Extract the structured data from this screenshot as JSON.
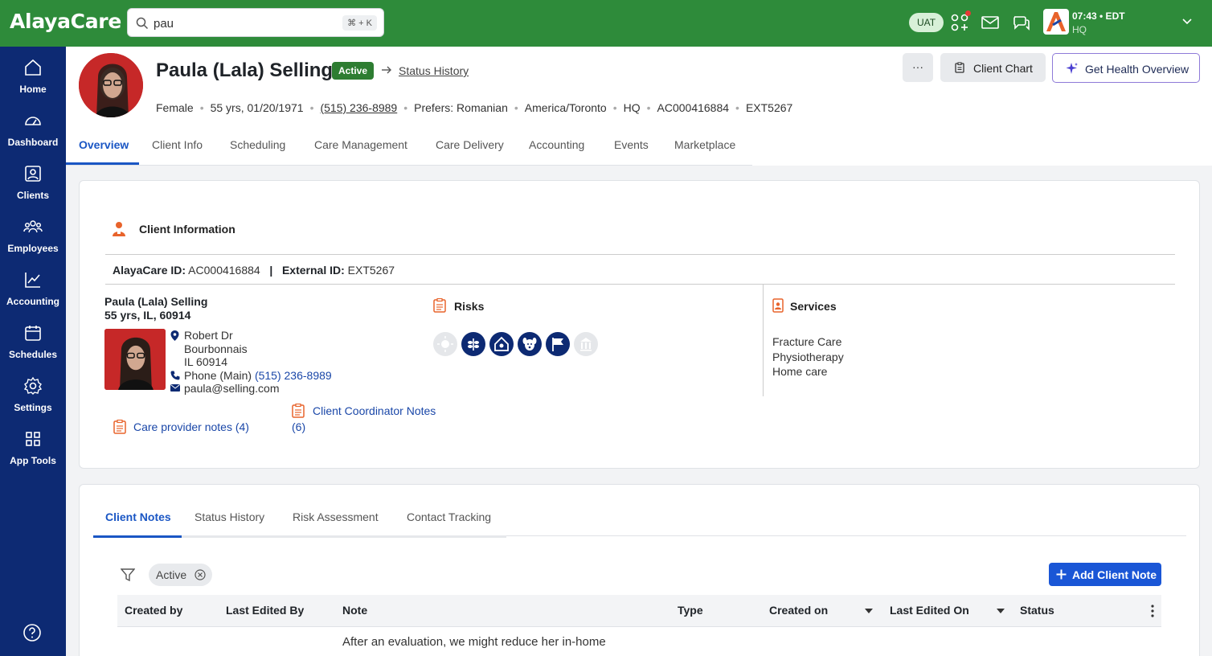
{
  "app": {
    "logo_text": "AlayaCare",
    "brand_green": "#2e8b3a",
    "nav_blue": "#0d2a73",
    "accent_blue": "#1a56c4"
  },
  "topbar": {
    "search_value": "pau",
    "search_shortcut": "⌘ + K",
    "env_badge": "UAT",
    "time": "07:43 • EDT",
    "location": "HQ",
    "icons": [
      "app-grid-icon",
      "mail-icon",
      "chat-icon"
    ]
  },
  "sidebar": {
    "items": [
      {
        "label": "Home",
        "icon": "home-icon"
      },
      {
        "label": "Dashboard",
        "icon": "dashboard-icon"
      },
      {
        "label": "Clients",
        "icon": "clients-icon"
      },
      {
        "label": "Employees",
        "icon": "employees-icon"
      },
      {
        "label": "Accounting",
        "icon": "accounting-icon"
      },
      {
        "label": "Schedules",
        "icon": "schedules-icon"
      },
      {
        "label": "Settings",
        "icon": "settings-icon"
      },
      {
        "label": "App Tools",
        "icon": "app-tools-icon"
      }
    ],
    "help_icon": "help-icon"
  },
  "client": {
    "name": "Paula (Lala) Selling",
    "status": "Active",
    "status_history_link": "Status History",
    "gender": "Female",
    "age_dob": "55 yrs, 01/20/1971",
    "phone": "(515) 236-8989",
    "language": "Prefers: Romanian",
    "timezone": "America/Toronto",
    "branch": "HQ",
    "alayacare_id": "AC000416884",
    "external_id": "EXT5267"
  },
  "header_actions": {
    "more": "···",
    "client_chart": "Client Chart",
    "health_overview": "Get Health Overview"
  },
  "tabs": [
    "Overview",
    "Client Info",
    "Scheduling",
    "Care Management",
    "Care Delivery",
    "Accounting",
    "Events",
    "Marketplace"
  ],
  "client_info_card": {
    "title": "Client Information",
    "alayacare_id_label": "AlayaCare ID:",
    "alayacare_id": "AC000416884",
    "separator": "|",
    "external_id_label": "External ID:",
    "external_id": "EXT5267",
    "name": "Paula (Lala) Selling",
    "age_location": "55 yrs, IL, 60914",
    "address_line1": "Robert Dr",
    "address_line2": "Bourbonnais",
    "address_line3": "IL 60914",
    "phone_label": "Phone (Main)",
    "phone": "(515) 236-8989",
    "email": "paula@selling.com",
    "care_provider_notes": "Care provider notes (4)",
    "coordinator_notes_line1": "Client Coordinator Notes",
    "coordinator_notes_line2": "(6)",
    "risks_title": "Risks",
    "risk_icons": [
      {
        "name": "sun-risk-icon",
        "active": false
      },
      {
        "name": "plant-allergy-risk-icon",
        "active": true
      },
      {
        "name": "home-safety-risk-icon",
        "active": true
      },
      {
        "name": "pet-risk-icon",
        "active": true
      },
      {
        "name": "flag-risk-icon",
        "active": true
      },
      {
        "name": "building-risk-icon",
        "active": false
      }
    ],
    "services_title": "Services",
    "services": [
      "Fracture Care",
      "Physiotherapy",
      "Home care"
    ]
  },
  "notes_card": {
    "tabs": [
      "Client Notes",
      "Status History",
      "Risk Assessment",
      "Contact Tracking"
    ],
    "filter_chip": "Active",
    "add_button": "Add Client Note",
    "columns": [
      "Created by",
      "Last Edited By",
      "Note",
      "Type",
      "Created on",
      "Last Edited On",
      "Status"
    ],
    "rows": [
      {
        "note": "After an evaluation, we might reduce her in-home"
      }
    ]
  }
}
